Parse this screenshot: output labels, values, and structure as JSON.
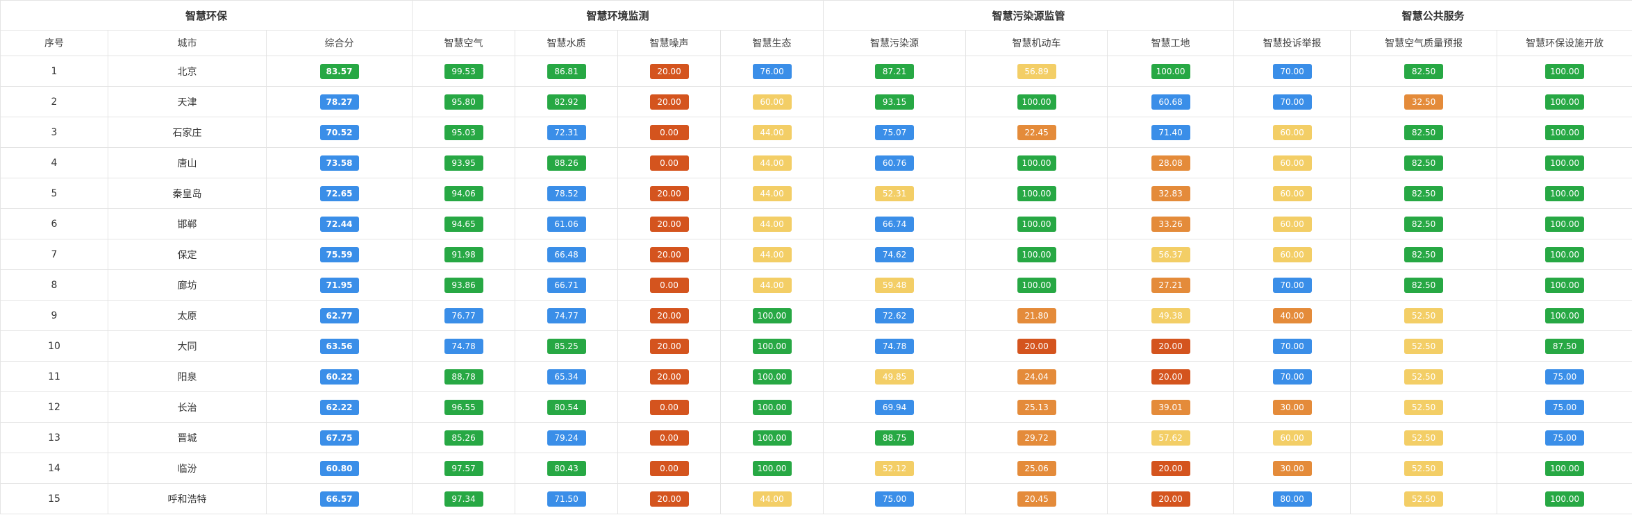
{
  "colors": {
    "green": "#27a844",
    "blue": "#3a8ee8",
    "red": "#d4541e",
    "orange": "#e48b3a",
    "yellow": "#f3ce66"
  },
  "groups": [
    {
      "label": "智慧环保",
      "span": 3
    },
    {
      "label": "智慧环境监测",
      "span": 4
    },
    {
      "label": "智慧污染源监管",
      "span": 3
    },
    {
      "label": "智慧公共服务",
      "span": 3
    }
  ],
  "columns": [
    "序号",
    "城市",
    "综合分",
    "智慧空气",
    "智慧水质",
    "智慧噪声",
    "智慧生态",
    "智慧污染源",
    "智慧机动车",
    "智慧工地",
    "智慧投诉举报",
    "智慧空气质量预报",
    "智慧环保设施开放"
  ],
  "rows": [
    {
      "idx": "1",
      "city": "北京",
      "cells": [
        [
          "83.57",
          "green"
        ],
        [
          "99.53",
          "green"
        ],
        [
          "86.81",
          "green"
        ],
        [
          "20.00",
          "red"
        ],
        [
          "76.00",
          "blue"
        ],
        [
          "87.21",
          "green"
        ],
        [
          "56.89",
          "yellow"
        ],
        [
          "100.00",
          "green"
        ],
        [
          "70.00",
          "blue"
        ],
        [
          "82.50",
          "green"
        ],
        [
          "100.00",
          "green"
        ]
      ]
    },
    {
      "idx": "2",
      "city": "天津",
      "cells": [
        [
          "78.27",
          "blue"
        ],
        [
          "95.80",
          "green"
        ],
        [
          "82.92",
          "green"
        ],
        [
          "20.00",
          "red"
        ],
        [
          "60.00",
          "yellow"
        ],
        [
          "93.15",
          "green"
        ],
        [
          "100.00",
          "green"
        ],
        [
          "60.68",
          "blue"
        ],
        [
          "70.00",
          "blue"
        ],
        [
          "32.50",
          "orange"
        ],
        [
          "100.00",
          "green"
        ]
      ]
    },
    {
      "idx": "3",
      "city": "石家庄",
      "cells": [
        [
          "70.52",
          "blue"
        ],
        [
          "95.03",
          "green"
        ],
        [
          "72.31",
          "blue"
        ],
        [
          "0.00",
          "red"
        ],
        [
          "44.00",
          "yellow"
        ],
        [
          "75.07",
          "blue"
        ],
        [
          "22.45",
          "orange"
        ],
        [
          "71.40",
          "blue"
        ],
        [
          "60.00",
          "yellow"
        ],
        [
          "82.50",
          "green"
        ],
        [
          "100.00",
          "green"
        ]
      ]
    },
    {
      "idx": "4",
      "city": "唐山",
      "cells": [
        [
          "73.58",
          "blue"
        ],
        [
          "93.95",
          "green"
        ],
        [
          "88.26",
          "green"
        ],
        [
          "0.00",
          "red"
        ],
        [
          "44.00",
          "yellow"
        ],
        [
          "60.76",
          "blue"
        ],
        [
          "100.00",
          "green"
        ],
        [
          "28.08",
          "orange"
        ],
        [
          "60.00",
          "yellow"
        ],
        [
          "82.50",
          "green"
        ],
        [
          "100.00",
          "green"
        ]
      ]
    },
    {
      "idx": "5",
      "city": "秦皇岛",
      "cells": [
        [
          "72.65",
          "blue"
        ],
        [
          "94.06",
          "green"
        ],
        [
          "78.52",
          "blue"
        ],
        [
          "20.00",
          "red"
        ],
        [
          "44.00",
          "yellow"
        ],
        [
          "52.31",
          "yellow"
        ],
        [
          "100.00",
          "green"
        ],
        [
          "32.83",
          "orange"
        ],
        [
          "60.00",
          "yellow"
        ],
        [
          "82.50",
          "green"
        ],
        [
          "100.00",
          "green"
        ]
      ]
    },
    {
      "idx": "6",
      "city": "邯郸",
      "cells": [
        [
          "72.44",
          "blue"
        ],
        [
          "94.65",
          "green"
        ],
        [
          "61.06",
          "blue"
        ],
        [
          "20.00",
          "red"
        ],
        [
          "44.00",
          "yellow"
        ],
        [
          "66.74",
          "blue"
        ],
        [
          "100.00",
          "green"
        ],
        [
          "33.26",
          "orange"
        ],
        [
          "60.00",
          "yellow"
        ],
        [
          "82.50",
          "green"
        ],
        [
          "100.00",
          "green"
        ]
      ]
    },
    {
      "idx": "7",
      "city": "保定",
      "cells": [
        [
          "75.59",
          "blue"
        ],
        [
          "91.98",
          "green"
        ],
        [
          "66.48",
          "blue"
        ],
        [
          "20.00",
          "red"
        ],
        [
          "44.00",
          "yellow"
        ],
        [
          "74.62",
          "blue"
        ],
        [
          "100.00",
          "green"
        ],
        [
          "56.37",
          "yellow"
        ],
        [
          "60.00",
          "yellow"
        ],
        [
          "82.50",
          "green"
        ],
        [
          "100.00",
          "green"
        ]
      ]
    },
    {
      "idx": "8",
      "city": "廊坊",
      "cells": [
        [
          "71.95",
          "blue"
        ],
        [
          "93.86",
          "green"
        ],
        [
          "66.71",
          "blue"
        ],
        [
          "0.00",
          "red"
        ],
        [
          "44.00",
          "yellow"
        ],
        [
          "59.48",
          "yellow"
        ],
        [
          "100.00",
          "green"
        ],
        [
          "27.21",
          "orange"
        ],
        [
          "70.00",
          "blue"
        ],
        [
          "82.50",
          "green"
        ],
        [
          "100.00",
          "green"
        ]
      ]
    },
    {
      "idx": "9",
      "city": "太原",
      "cells": [
        [
          "62.77",
          "blue"
        ],
        [
          "76.77",
          "blue"
        ],
        [
          "74.77",
          "blue"
        ],
        [
          "20.00",
          "red"
        ],
        [
          "100.00",
          "green"
        ],
        [
          "72.62",
          "blue"
        ],
        [
          "21.80",
          "orange"
        ],
        [
          "49.38",
          "yellow"
        ],
        [
          "40.00",
          "orange"
        ],
        [
          "52.50",
          "yellow"
        ],
        [
          "100.00",
          "green"
        ]
      ]
    },
    {
      "idx": "10",
      "city": "大同",
      "cells": [
        [
          "63.56",
          "blue"
        ],
        [
          "74.78",
          "blue"
        ],
        [
          "85.25",
          "green"
        ],
        [
          "20.00",
          "red"
        ],
        [
          "100.00",
          "green"
        ],
        [
          "74.78",
          "blue"
        ],
        [
          "20.00",
          "red"
        ],
        [
          "20.00",
          "red"
        ],
        [
          "70.00",
          "blue"
        ],
        [
          "52.50",
          "yellow"
        ],
        [
          "87.50",
          "green"
        ]
      ]
    },
    {
      "idx": "11",
      "city": "阳泉",
      "cells": [
        [
          "60.22",
          "blue"
        ],
        [
          "88.78",
          "green"
        ],
        [
          "65.34",
          "blue"
        ],
        [
          "20.00",
          "red"
        ],
        [
          "100.00",
          "green"
        ],
        [
          "49.85",
          "yellow"
        ],
        [
          "24.04",
          "orange"
        ],
        [
          "20.00",
          "red"
        ],
        [
          "70.00",
          "blue"
        ],
        [
          "52.50",
          "yellow"
        ],
        [
          "75.00",
          "blue"
        ]
      ]
    },
    {
      "idx": "12",
      "city": "长治",
      "cells": [
        [
          "62.22",
          "blue"
        ],
        [
          "96.55",
          "green"
        ],
        [
          "80.54",
          "green"
        ],
        [
          "0.00",
          "red"
        ],
        [
          "100.00",
          "green"
        ],
        [
          "69.94",
          "blue"
        ],
        [
          "25.13",
          "orange"
        ],
        [
          "39.01",
          "orange"
        ],
        [
          "30.00",
          "orange"
        ],
        [
          "52.50",
          "yellow"
        ],
        [
          "75.00",
          "blue"
        ]
      ]
    },
    {
      "idx": "13",
      "city": "晋城",
      "cells": [
        [
          "67.75",
          "blue"
        ],
        [
          "85.26",
          "green"
        ],
        [
          "79.24",
          "blue"
        ],
        [
          "0.00",
          "red"
        ],
        [
          "100.00",
          "green"
        ],
        [
          "88.75",
          "green"
        ],
        [
          "29.72",
          "orange"
        ],
        [
          "57.62",
          "yellow"
        ],
        [
          "60.00",
          "yellow"
        ],
        [
          "52.50",
          "yellow"
        ],
        [
          "75.00",
          "blue"
        ]
      ]
    },
    {
      "idx": "14",
      "city": "临汾",
      "cells": [
        [
          "60.80",
          "blue"
        ],
        [
          "97.57",
          "green"
        ],
        [
          "80.43",
          "green"
        ],
        [
          "0.00",
          "red"
        ],
        [
          "100.00",
          "green"
        ],
        [
          "52.12",
          "yellow"
        ],
        [
          "25.06",
          "orange"
        ],
        [
          "20.00",
          "red"
        ],
        [
          "30.00",
          "orange"
        ],
        [
          "52.50",
          "yellow"
        ],
        [
          "100.00",
          "green"
        ]
      ]
    },
    {
      "idx": "15",
      "city": "呼和浩特",
      "cells": [
        [
          "66.57",
          "blue"
        ],
        [
          "97.34",
          "green"
        ],
        [
          "71.50",
          "blue"
        ],
        [
          "20.00",
          "red"
        ],
        [
          "44.00",
          "yellow"
        ],
        [
          "75.00",
          "blue"
        ],
        [
          "20.45",
          "orange"
        ],
        [
          "20.00",
          "red"
        ],
        [
          "80.00",
          "blue"
        ],
        [
          "52.50",
          "yellow"
        ],
        [
          "100.00",
          "green"
        ]
      ]
    }
  ]
}
